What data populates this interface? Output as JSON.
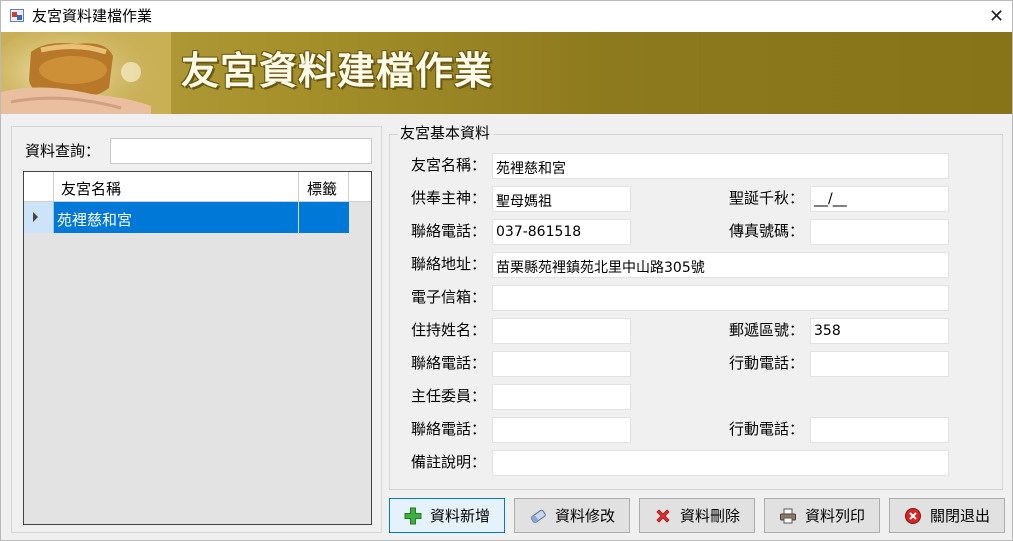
{
  "window": {
    "title": "友宮資料建檔作業",
    "close_symbol": "✕"
  },
  "banner": {
    "title": "友宮資料建檔作業"
  },
  "search": {
    "label": "資料查詢：",
    "value": ""
  },
  "grid": {
    "columns": [
      "友宮名稱",
      "標籤"
    ],
    "rows": [
      {
        "name": "苑裡慈和宮",
        "tag": ""
      }
    ]
  },
  "form": {
    "group_title": "友宮基本資料",
    "temple_name": {
      "label": "友宮名稱：",
      "value": "苑裡慈和宮"
    },
    "deity": {
      "label": "供奉主神：",
      "value": "聖母媽祖"
    },
    "birthday": {
      "label": "聖誕千秋：",
      "value": "__/__"
    },
    "phone": {
      "label": "聯絡電話：",
      "value": "037-861518"
    },
    "fax": {
      "label": "傳真號碼：",
      "value": ""
    },
    "address": {
      "label": "聯絡地址：",
      "value": "苗栗縣苑裡鎮苑北里中山路305號"
    },
    "email": {
      "label": "電子信箱：",
      "value": ""
    },
    "abbot_name": {
      "label": "住持姓名：",
      "value": ""
    },
    "postal_code": {
      "label": "郵遞區號：",
      "value": "358"
    },
    "abbot_phone": {
      "label": "聯絡電話：",
      "value": ""
    },
    "abbot_mobile": {
      "label": "行動電話：",
      "value": ""
    },
    "chairman": {
      "label": "主任委員：",
      "value": ""
    },
    "chairman_phone": {
      "label": "聯絡電話：",
      "value": ""
    },
    "chairman_mobile": {
      "label": "行動電話：",
      "value": ""
    },
    "notes": {
      "label": "備註說明：",
      "value": ""
    }
  },
  "buttons": {
    "add": "資料新增",
    "edit": "資料修改",
    "delete": "資料刪除",
    "print": "資料列印",
    "exit": "關閉退出"
  },
  "colors": {
    "selection": "#0078d7",
    "banner": "#8d7a1e",
    "banner_text": "#fffbe8"
  }
}
